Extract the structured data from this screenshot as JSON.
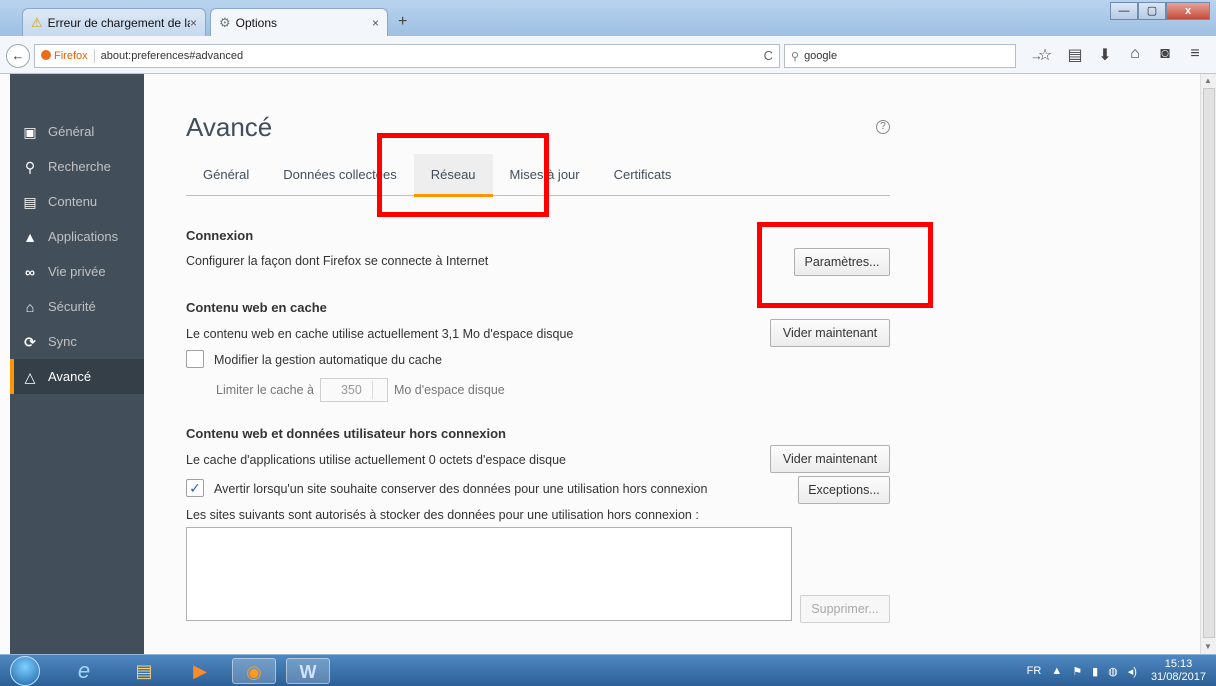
{
  "browser": {
    "tabs": [
      {
        "label": "Erreur de chargement de la...",
        "active": false,
        "icon": "warning-icon"
      },
      {
        "label": "Options",
        "active": true,
        "icon": "gear-icon"
      }
    ],
    "new_tab": "+",
    "tab_close": "×",
    "window_buttons": {
      "minimize": "—",
      "maximize": "▢",
      "close": "x"
    },
    "url_badge": "Firefox",
    "url": "about:preferences#advanced",
    "search_value": "google",
    "back": "←",
    "reload": "C",
    "search_go": "→",
    "search_icon": "⚲",
    "toolbar_icons": [
      {
        "name": "bookmark-star-icon",
        "glyph": "☆"
      },
      {
        "name": "bookmarks-list-icon",
        "glyph": "▤"
      },
      {
        "name": "downloads-icon",
        "glyph": "⬇"
      },
      {
        "name": "home-icon",
        "glyph": "⌂"
      },
      {
        "name": "pocket-icon",
        "glyph": "◙"
      },
      {
        "name": "menu-icon",
        "glyph": "≡"
      }
    ]
  },
  "sidebar": {
    "items": [
      {
        "label": "Général",
        "icon": "general-icon",
        "glyph": "▣",
        "selected": false
      },
      {
        "label": "Recherche",
        "icon": "search-icon",
        "glyph": "⚲",
        "selected": false
      },
      {
        "label": "Contenu",
        "icon": "content-icon",
        "glyph": "▤",
        "selected": false
      },
      {
        "label": "Applications",
        "icon": "applications-icon",
        "glyph": "▲",
        "selected": false
      },
      {
        "label": "Vie privée",
        "icon": "privacy-mask-icon",
        "glyph": "∞",
        "selected": false
      },
      {
        "label": "Sécurité",
        "icon": "lock-icon",
        "glyph": "⌂",
        "selected": false
      },
      {
        "label": "Sync",
        "icon": "sync-icon",
        "glyph": "⟳",
        "selected": false
      },
      {
        "label": "Avancé",
        "icon": "advanced-wizard-icon",
        "glyph": "△",
        "selected": true
      }
    ]
  },
  "main": {
    "title": "Avancé",
    "help": "?",
    "tabs": [
      {
        "label": "Général",
        "selected": false
      },
      {
        "label": "Données collectées",
        "selected": false
      },
      {
        "label": "Réseau",
        "selected": true
      },
      {
        "label": "Mises à jour",
        "selected": false
      },
      {
        "label": "Certificats",
        "selected": false
      }
    ],
    "connection": {
      "title": "Connexion",
      "description": "Configurer la façon dont Firefox se connecte à Internet",
      "button": "Paramètres..."
    },
    "web_cache": {
      "title": "Contenu web en cache",
      "usage": "Le contenu web en cache utilise actuellement 3,1 Mo d'espace disque",
      "clear_button": "Vider maintenant",
      "override_label": "Modifier la gestion automatique du cache",
      "override_checked": false,
      "limit_label": "Limiter le cache à",
      "limit_value": "350",
      "limit_unit": "Mo d'espace disque"
    },
    "offline": {
      "title": "Contenu web et données utilisateur hors connexion",
      "usage": "Le cache d'applications utilise actuellement 0 octets d'espace disque",
      "clear_button": "Vider maintenant",
      "notify_label": "Avertir lorsqu'un site souhaite conserver des données pour une utilisation hors connexion",
      "notify_checked": true,
      "check_glyph": "✓",
      "exceptions_button": "Exceptions...",
      "allowed_label": "Les sites suivants sont autorisés à stocker des données pour une utilisation hors connexion :",
      "remove_button": "Supprimer..."
    }
  },
  "taskbar": {
    "apps": [
      {
        "name": "internet-explorer-icon",
        "glyph": "e",
        "active": false
      },
      {
        "name": "file-explorer-icon",
        "glyph": "▤",
        "active": false
      },
      {
        "name": "media-player-icon",
        "glyph": "▶",
        "active": false
      },
      {
        "name": "firefox-icon",
        "glyph": "◉",
        "active": true
      },
      {
        "name": "word-icon",
        "glyph": "W",
        "active": true
      }
    ],
    "language": "FR",
    "time": "15:13",
    "date": "31/08/2017"
  },
  "colors": {
    "accent": "#ff9500",
    "sidebar_bg": "#424f5a",
    "highlight": "#ff0000"
  }
}
